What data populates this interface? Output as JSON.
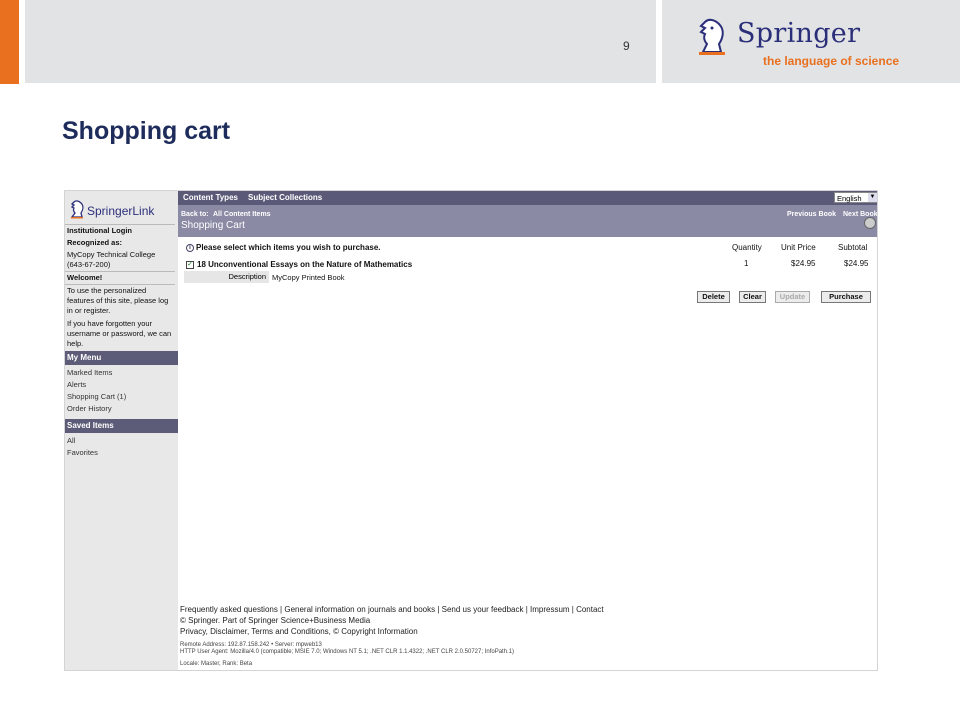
{
  "slide": {
    "page_number": "9",
    "title": "Shopping cart",
    "logo_word": "Springer",
    "logo_tagline": "the language of science"
  },
  "colors": {
    "accent": "#e8701f",
    "brand_blue": "#2b2f7a",
    "nav_bar": "#5a5a78"
  },
  "browser": {
    "springerlink_logo": "SpringerLink",
    "sidebar": {
      "institutional_login": "Institutional Login",
      "recognized_as": "Recognized as:",
      "institution": "MyCopy Technical College",
      "institution_id": "(643-67-200)",
      "welcome": "Welcome!",
      "personalized_text": "To use the personalized features of this site, please log in or register.",
      "forgotten_text": "If you have forgotten your username or password, we can help.",
      "my_menu_label": "My Menu",
      "my_menu_items": [
        "Marked Items",
        "Alerts",
        "Shopping Cart (1)",
        "Order History"
      ],
      "saved_items_label": "Saved Items",
      "saved_items": [
        "All",
        "Favorites"
      ]
    },
    "nav": {
      "content_types": "Content Types",
      "subject_collections": "Subject Collections",
      "language": "English"
    },
    "subnav": {
      "back_to": "Back to:",
      "back_link": "All Content Items",
      "page_title": "Shopping Cart",
      "previous_book": "Previous Book",
      "next_book": "Next Book"
    },
    "cart": {
      "instruction": "Please select which items you wish to purchase.",
      "col_quantity": "Quantity",
      "col_unit_price": "Unit Price",
      "col_subtotal": "Subtotal",
      "item_title": "18 Unconventional Essays on the Nature of Mathematics",
      "item_quantity": "1",
      "item_unit_price": "$24.95",
      "item_subtotal": "$24.95",
      "description_label": "Description",
      "description_value": "MyCopy Printed Book",
      "buttons": {
        "delete": "Delete",
        "clear": "Clear",
        "update": "Update",
        "purchase": "Purchase"
      }
    },
    "footer": {
      "links": "Frequently asked questions | General information on journals and books | Send us your feedback | Impressum | Contact",
      "copyright": "© Springer. Part of Springer Science+Business Media",
      "legal": "Privacy, Disclaimer, Terms and Conditions, © Copyright Information",
      "remote": "Remote Address: 192.87.158.242 • Server: mpweb13",
      "agent": "HTTP User Agent: Mozilla/4.0 (compatible; MSIE 7.0; Windows NT 5.1; .NET CLR 1.1.4322; .NET CLR 2.0.50727; InfoPath.1)",
      "locale": "Locale: Master, Rank: Beta"
    }
  }
}
